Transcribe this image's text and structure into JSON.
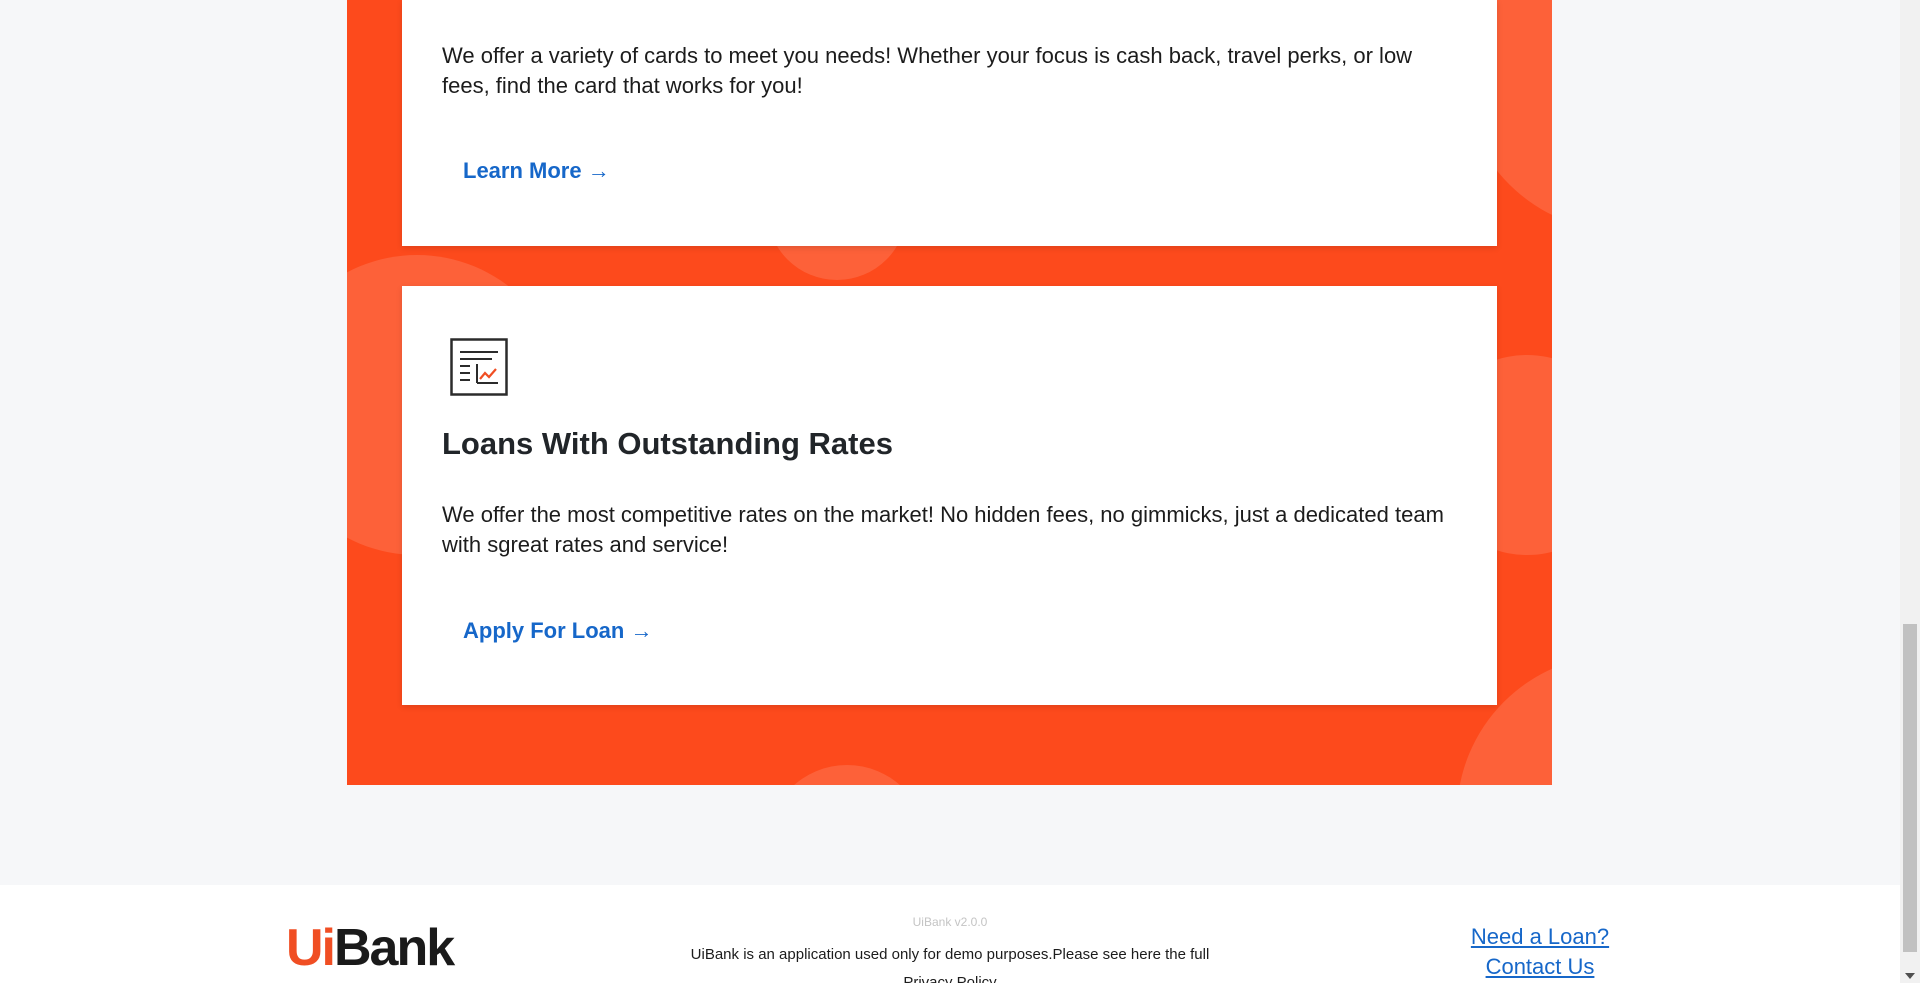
{
  "cards": {
    "credit": {
      "text": "We offer a variety of cards to meet you needs! Whether your focus is cash back, travel perks, or low fees, find the card that works for you!",
      "link_label": "Learn More →"
    },
    "loans": {
      "icon": "report-chart-icon",
      "title": "Loans With Outstanding Rates",
      "text": "We offer the most competitive rates on the market! No hidden fees, no gimmicks, just a dedicated team with sgreat rates and service!",
      "link_label": "Apply For Loan →"
    }
  },
  "footer": {
    "logo_ui": "Ui",
    "logo_bank": "Bank",
    "version": "UiBank v2.0.0",
    "disclaimer": "UiBank is an application used only for demo purposes.Please see here the full",
    "privacy_link": "Privacy Policy",
    "links": [
      "Need a Loan?",
      "Contact Us"
    ]
  },
  "colors": {
    "brand_orange": "#fd4a1c",
    "link_blue": "#1667c9"
  }
}
